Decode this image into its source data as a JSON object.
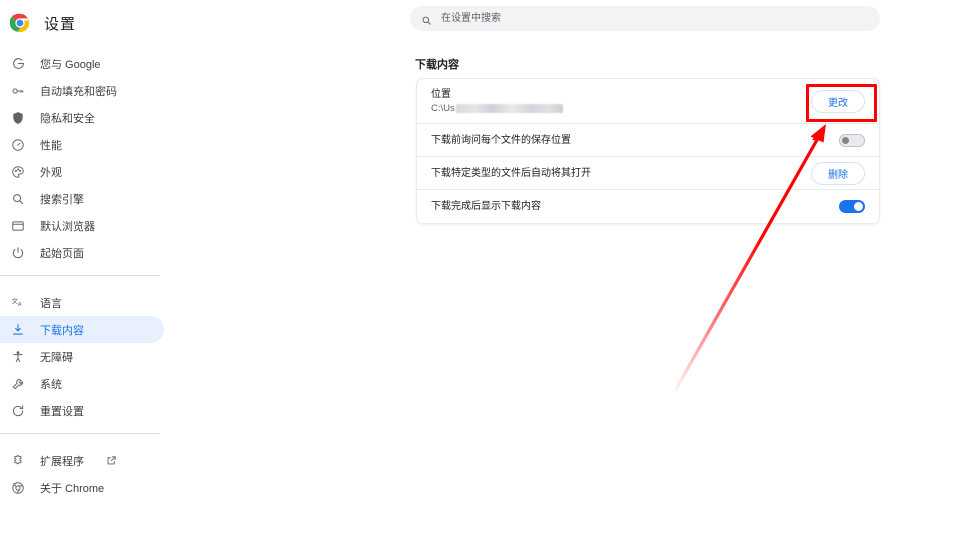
{
  "window": {
    "app_title": "设置",
    "logo_icon": "chrome-logo-icon"
  },
  "search": {
    "placeholder": "在设置中搜索",
    "value": "",
    "icon": "search-icon"
  },
  "sidebar": {
    "groups": [
      {
        "items": [
          {
            "label": "您与 Google",
            "icon": "google-g-icon",
            "selected": false
          },
          {
            "label": "自动填充和密码",
            "icon": "key-icon",
            "selected": false
          },
          {
            "label": "隐私和安全",
            "icon": "shield-icon",
            "selected": false
          },
          {
            "label": "性能",
            "icon": "speedometer-icon",
            "selected": false
          },
          {
            "label": "外观",
            "icon": "palette-icon",
            "selected": false
          },
          {
            "label": "搜索引擎",
            "icon": "search-icon",
            "selected": false
          },
          {
            "label": "默认浏览器",
            "icon": "browser-window-icon",
            "selected": false
          },
          {
            "label": "起始页面",
            "icon": "power-icon",
            "selected": false
          }
        ]
      },
      {
        "items": [
          {
            "label": "语言",
            "icon": "translate-icon",
            "selected": false
          },
          {
            "label": "下载内容",
            "icon": "download-icon",
            "selected": true
          },
          {
            "label": "无障碍",
            "icon": "accessibility-icon",
            "selected": false
          },
          {
            "label": "系统",
            "icon": "wrench-icon",
            "selected": false
          },
          {
            "label": "重置设置",
            "icon": "restore-icon",
            "selected": false
          }
        ]
      },
      {
        "items": [
          {
            "label": "扩展程序",
            "icon": "puzzle-icon",
            "selected": false,
            "external_link_icon": "open-in-new-icon"
          },
          {
            "label": "关于 Chrome",
            "icon": "chrome-logo-icon",
            "selected": false
          }
        ]
      }
    ]
  },
  "main": {
    "section_title": "下载内容",
    "rows": {
      "location": {
        "label": "位置",
        "path_prefix": "C:\\Us",
        "path_redacted": true,
        "button_label": "更改"
      },
      "ask_where_to_save": {
        "label": "下载前询问每个文件的保存位置",
        "toggle_state": "off"
      },
      "auto_open": {
        "label": "下载特定类型的文件后自动将其打开",
        "button_label": "删除"
      },
      "show_downloads_when_done": {
        "label": "下载完成后显示下载内容",
        "toggle_state": "on"
      }
    }
  },
  "annotations": {
    "highlight_box": {
      "name": "change-button-highlight",
      "color": "#ff0000"
    },
    "arrow": {
      "name": "pointer-arrow",
      "color": "#ff0000",
      "points_to": "更改"
    }
  },
  "colors": {
    "accent_blue": "#1a73e8",
    "selected_bg": "#e8f0fe",
    "annotation_red": "#ff0000",
    "toggle_off": "#80868b"
  }
}
